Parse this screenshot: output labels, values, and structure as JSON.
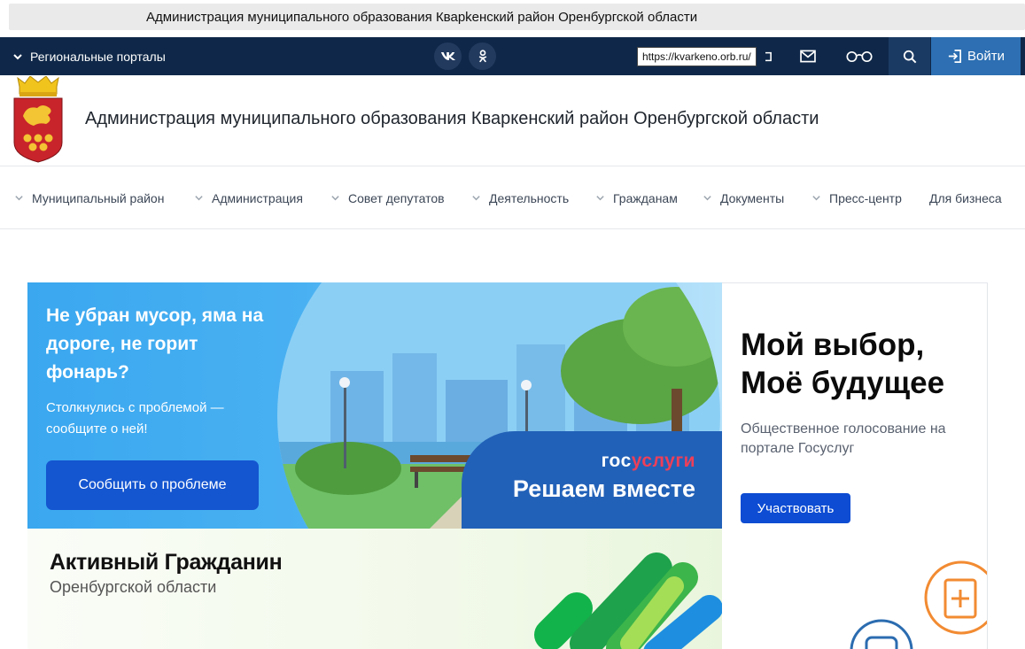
{
  "window": {
    "title": "Администрация муниципального образования Кварkенский район Оренбургской области"
  },
  "topnav": {
    "regional_label": "Региональные порталы",
    "social_vk": "vk",
    "social_ok": "ok",
    "url_tooltip": "https://kvarkeno.orb.ru/",
    "login_label": "Войти"
  },
  "header": {
    "site_title": "Администрация муниципального образования Кваркенский район Оренбургской области"
  },
  "menu": {
    "items": [
      {
        "label": "Муниципальный район"
      },
      {
        "label": "Администрация"
      },
      {
        "label": "Совет депутатов"
      },
      {
        "label": "Деятельность"
      },
      {
        "label": "Гражданам"
      },
      {
        "label": "Документы"
      },
      {
        "label": "Пресс-центр"
      },
      {
        "label": "Для бизнеса"
      }
    ]
  },
  "banner_problem": {
    "title": "Не убран мусор, яма на дороге, не горит фонарь?",
    "subtitle": "Столкнулись с проблемой — сообщите о ней!",
    "button": "Сообщить о проблеме",
    "gos_logo_1": "гос",
    "gos_logo_2": "услуги",
    "slogan": "Решаем вместе"
  },
  "card_vote": {
    "title_line1": "Мой выбор,",
    "title_line2": "Моё будущее",
    "subtitle": "Общественное голосование на портале Госуслуг",
    "button": "Участвовать"
  },
  "banner_active": {
    "title": "Активный Гражданин",
    "subtitle": "Оренбургской области"
  },
  "colors": {
    "topnav_bg": "#0f2849",
    "login_bg": "#2d6fb2",
    "problem_button": "#1455d0",
    "vote_button": "#0d4cd3",
    "gos_accent": "#ee3f58"
  }
}
